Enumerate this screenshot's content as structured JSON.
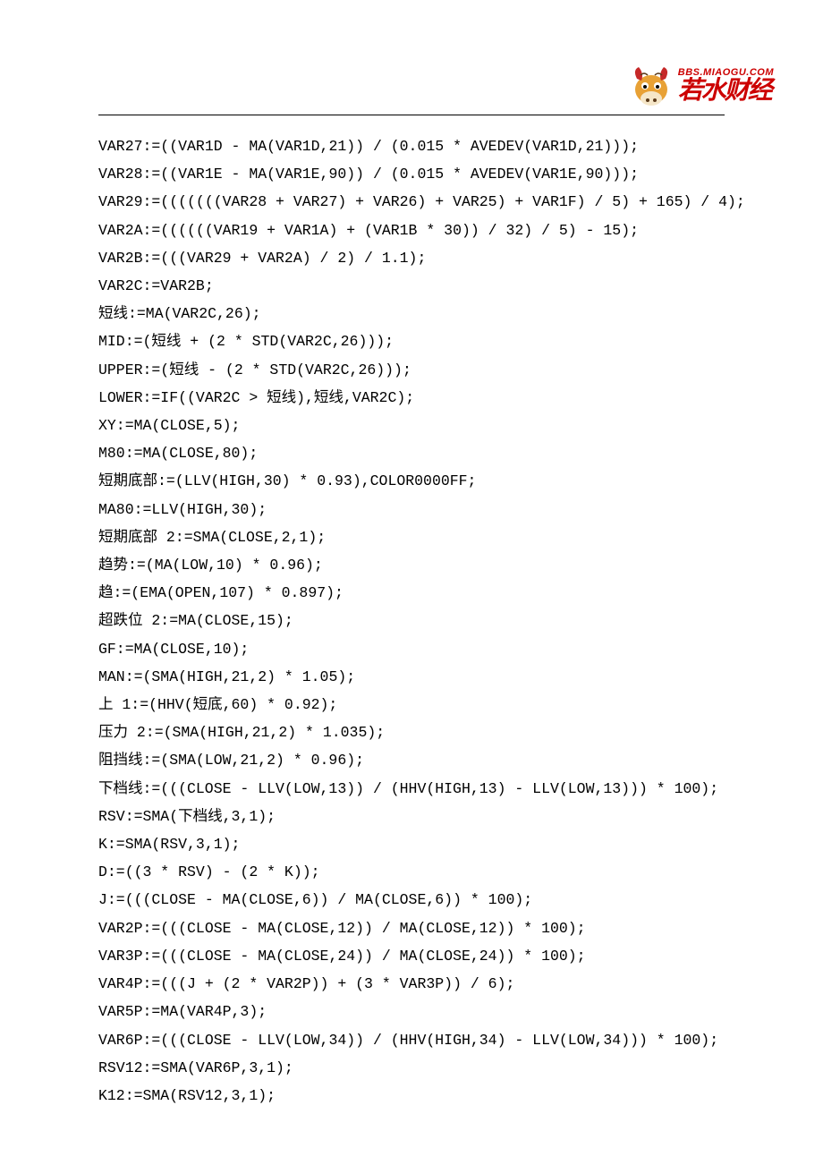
{
  "logo": {
    "url": "BBS.MIAOGU.COM",
    "cn": "若水财经"
  },
  "code_lines": [
    "VAR27:=((VAR1D - MA(VAR1D,21)) / (0.015 * AVEDEV(VAR1D,21)));",
    "VAR28:=((VAR1E - MA(VAR1E,90)) / (0.015 * AVEDEV(VAR1E,90)));",
    "VAR29:=(((((((VAR28 + VAR27) + VAR26) + VAR25) + VAR1F) / 5) + 165) / 4);",
    "VAR2A:=((((((VAR19 + VAR1A) + (VAR1B * 30)) / 32) / 5) - 15);",
    "VAR2B:=(((VAR29 + VAR2A) / 2) / 1.1);",
    "VAR2C:=VAR2B;",
    "短线:=MA(VAR2C,26);",
    "MID:=(短线 + (2 * STD(VAR2C,26)));",
    "UPPER:=(短线 - (2 * STD(VAR2C,26)));",
    "LOWER:=IF((VAR2C > 短线),短线,VAR2C);",
    "XY:=MA(CLOSE,5);",
    "M80:=MA(CLOSE,80);",
    "短期底部:=(LLV(HIGH,30) * 0.93),COLOR0000FF;",
    "MA80:=LLV(HIGH,30);",
    "短期底部 2:=SMA(CLOSE,2,1);",
    "趋势:=(MA(LOW,10) * 0.96);",
    "趋:=(EMA(OPEN,107) * 0.897);",
    "超跌位 2:=MA(CLOSE,15);",
    "GF:=MA(CLOSE,10);",
    "MAN:=(SMA(HIGH,21,2) * 1.05);",
    "上 1:=(HHV(短底,60) * 0.92);",
    "压力 2:=(SMA(HIGH,21,2) * 1.035);",
    "阻挡线:=(SMA(LOW,21,2) * 0.96);",
    "下档线:=(((CLOSE - LLV(LOW,13)) / (HHV(HIGH,13) - LLV(LOW,13))) * 100);",
    "RSV:=SMA(下档线,3,1);",
    "K:=SMA(RSV,3,1);",
    "D:=((3 * RSV) - (2 * K));",
    "J:=(((CLOSE - MA(CLOSE,6)) / MA(CLOSE,6)) * 100);",
    "VAR2P:=(((CLOSE - MA(CLOSE,12)) / MA(CLOSE,12)) * 100);",
    "VAR3P:=(((CLOSE - MA(CLOSE,24)) / MA(CLOSE,24)) * 100);",
    "VAR4P:=(((J + (2 * VAR2P)) + (3 * VAR3P)) / 6);",
    "VAR5P:=MA(VAR4P,3);",
    "VAR6P:=(((CLOSE - LLV(LOW,34)) / (HHV(HIGH,34) - LLV(LOW,34))) * 100);",
    "RSV12:=SMA(VAR6P,3,1);",
    "K12:=SMA(RSV12,3,1);"
  ]
}
